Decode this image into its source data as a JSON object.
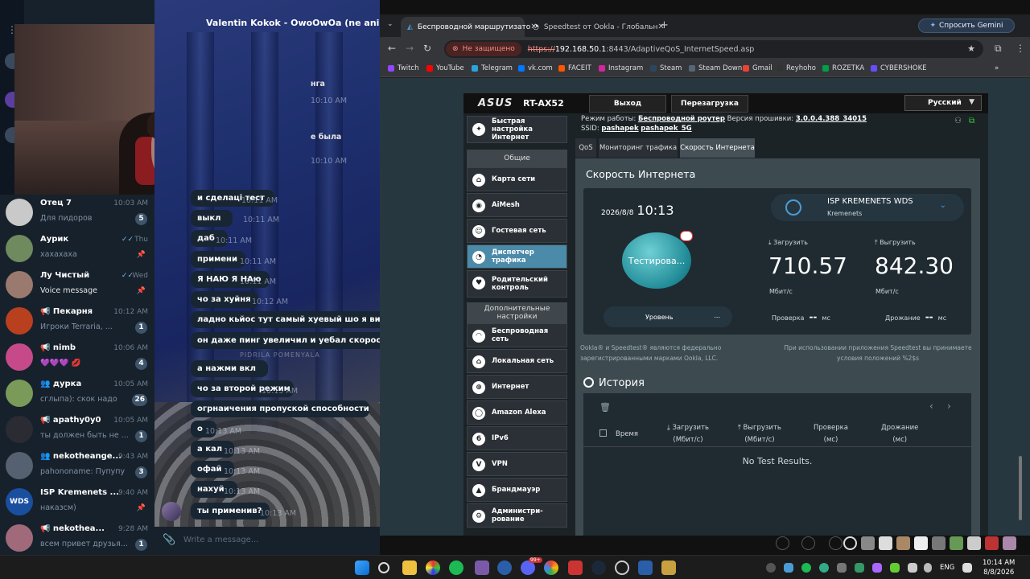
{
  "telegram": {
    "header_name": "Valentin Kokok - OwoOwOa (ne anime)",
    "chats": [
      {
        "name": "Отец 7",
        "time": "10:03 AM",
        "preview": "Для пидоров",
        "badge": "5",
        "avatar_color": "#c9c9c9"
      },
      {
        "name": "Аурик",
        "time": "Thu",
        "preview": "хахахаха",
        "check": "✓✓",
        "pin": true,
        "avatar_color": "#6f8a5e"
      },
      {
        "name": "Лу Чистый",
        "time": "Wed",
        "preview": "Voice message",
        "check": "✓✓",
        "pin": true,
        "avatar_color": "#9a7a6e"
      },
      {
        "name": "📢 Пекарня",
        "time": "10:12 AM",
        "preview": "Игроки Terraria, ...",
        "badge": "1",
        "avatar_color": "#b9401f"
      },
      {
        "name": "📢 nimb",
        "time": "10:06 AM",
        "preview": "💜💜💜 💋",
        "badge": "4",
        "avatar_color": "#c64a8a"
      },
      {
        "name": "👥 дурка",
        "time": "10:05 AM",
        "preview": "сглыпа): скок надо",
        "badge": "26",
        "avatar_color": "#7a9a5a"
      },
      {
        "name": "📢 apathy0y0",
        "time": "10:05 AM",
        "preview": "ты должен быть не ...",
        "badge": "1",
        "avatar_color": "#2b2b33"
      },
      {
        "name": "👥 nekotheange...",
        "time": "9:43 AM",
        "preview": "pahononame: Пупупу",
        "badge": "3",
        "avatar_color": "#556070"
      },
      {
        "name": "ISP Kremenets ...",
        "time": "9:40 AM",
        "preview": "наказсм)",
        "pin": true,
        "avatar_color": "#1a4fa0",
        "avatar_text": "WDS"
      },
      {
        "name": "📢 nekothea...",
        "time": "9:28 AM",
        "preview": "всем привет друзья...",
        "badge": "1",
        "avatar_color": "#a06a7a"
      }
    ],
    "messages": [
      {
        "text": "и сделаці тест",
        "time": "10:11 AM"
      },
      {
        "text": "выкл",
        "time": "10:11 AM"
      },
      {
        "text": "даб",
        "time": "10:11 AM"
      },
      {
        "text": "примени",
        "time": "10:11 AM"
      },
      {
        "text": "Я НАЮ Я НАю",
        "time": "10:11 AM"
      },
      {
        "text": "чо за хуйня",
        "time": "10:12 AM"
      },
      {
        "text": "ладно кьйос тут самый хуевый шо я видел",
        "time": "10:12 AM"
      },
      {
        "text": "он даже пинг увеличил и уебал скорость",
        "time": "10:12 AM"
      },
      {
        "text": "а нажми вкл",
        "time": "10:13 AM"
      },
      {
        "text": "чо за второй режим",
        "time": "10:13 AM"
      },
      {
        "text": "огрнаичения пропуской способности",
        "time": "10:13 AM"
      },
      {
        "text": "о",
        "time": "10:13 AM"
      },
      {
        "text": "а кал",
        "time": "10:13 AM"
      },
      {
        "text": "офай",
        "time": "10:13 AM"
      },
      {
        "text": "нахуй",
        "time": "10:13 AM"
      },
      {
        "text": "ты применив?",
        "time": "10:13 AM"
      }
    ],
    "bg_frag_1": "нга",
    "bg_frag_2": "е была",
    "bg_time_1": "10:10 AM",
    "bg_time_2": "10:10 AM",
    "watermark": "PIDRILA POMENYALA",
    "input_placeholder": "Write a message..."
  },
  "browser": {
    "tabs": [
      {
        "title": "Беспроводной маршрутизато",
        "active": true
      },
      {
        "title": "Speedtest от Ookla - Глобальн",
        "active": false
      }
    ],
    "gemini_label": "Спросить Gemini",
    "security_label": "Не защищено",
    "url_scheme": "https://",
    "url_host": "192.168.50.1",
    "url_rest": ":8443/AdaptiveQoS_InternetSpeed.asp",
    "bookmarks": [
      {
        "label": "Twitch",
        "color": "#9146ff"
      },
      {
        "label": "YouTube",
        "color": "#ff0000"
      },
      {
        "label": "Telegram",
        "color": "#2aa3df"
      },
      {
        "label": "vk.com",
        "color": "#0077ff"
      },
      {
        "label": "FACEIT",
        "color": "#ff5500"
      },
      {
        "label": "Instagram",
        "color": "#d6249f"
      },
      {
        "label": "Steam",
        "color": "#2a475e"
      },
      {
        "label": "Steam Down",
        "color": "#556677"
      },
      {
        "label": "Gmail",
        "color": "#ea4335"
      },
      {
        "label": "Reyhoho",
        "color": "#333333"
      },
      {
        "label": "ROZETKA",
        "color": "#00a046"
      },
      {
        "label": "CYBERSHOKE",
        "color": "#6a4cff"
      }
    ]
  },
  "router": {
    "logo": "ASUS",
    "model": "RT-AX52",
    "logout": "Выход",
    "reboot": "Перезагрузка",
    "language": "Русский",
    "mode_label": "Режим работы:",
    "mode_value": "Беспроводной роутер",
    "fw_label": "Версия прошивки:",
    "fw_value": "3.0.0.4.388_34015",
    "ssid_label": "SSID:",
    "ssid_1": "pashapek",
    "ssid_2": "pashapek_5G",
    "quick_setup": "Быстрая настройка Интернет",
    "general_header": "Общие",
    "general_items": [
      {
        "label": "Карта сети",
        "icon": "map"
      },
      {
        "label": "AiMesh",
        "icon": "mesh"
      },
      {
        "label": "Гостевая сеть",
        "icon": "guest"
      },
      {
        "label": "Диспетчер трафика",
        "icon": "traffic",
        "active": true
      },
      {
        "label": "Родительский контроль",
        "icon": "parental"
      }
    ],
    "advanced_header": "Дополнительные настройки",
    "advanced_items": [
      {
        "label": "Беспроводная сеть",
        "icon": "wifi"
      },
      {
        "label": "Локальная сеть",
        "icon": "lan"
      },
      {
        "label": "Интернет",
        "icon": "wan"
      },
      {
        "label": "Amazon Alexa",
        "icon": "alexa"
      },
      {
        "label": "IPv6",
        "icon": "ipv6"
      },
      {
        "label": "VPN",
        "icon": "vpn"
      },
      {
        "label": "Брандмауэр",
        "icon": "firewall"
      },
      {
        "label": "Администри-рование",
        "icon": "admin"
      }
    ],
    "tabs": [
      "QoS",
      "Мониторинг трафика",
      "Скорость Интернета"
    ],
    "speed_title": "Скорость Интернета",
    "date": "2026/8/8",
    "time": "10:13",
    "isp_name": "ISP KREMENETS WDS",
    "isp_city": "Kremenets",
    "gauge_label": "Тестирова...",
    "download_label": "Загрузить",
    "download_value": "710.57",
    "download_unit": "Мбит/с",
    "upload_label": "Выгрузить",
    "upload_value": "842.30",
    "upload_unit": "Мбит/с",
    "level_label": "Уровень",
    "level_dots": "...",
    "ping_label": "Проверка",
    "ping_value": "--",
    "ping_unit": "мс",
    "jitter_label": "Дрожание",
    "jitter_value": "--",
    "jitter_unit": "мс",
    "ookla_left": "Ookla® и Speedtest® являются федерально зарегистрированными марками Ookla, LLC.",
    "ookla_right": "При использовании приложения Speedtest вы принимаете условия положений %2$s",
    "history_title": "История",
    "hist_cols": [
      {
        "l1": "Время",
        "l2": ""
      },
      {
        "l1": "Загрузить",
        "l2": "(Мбит/с)"
      },
      {
        "l1": "Выгрузить",
        "l2": "(Мбит/с)"
      },
      {
        "l1": "Проверка",
        "l2": "(мс)"
      },
      {
        "l1": "Дрожание",
        "l2": "(мс)"
      }
    ],
    "no_results": "No Test Results."
  },
  "taskbar": {
    "lang": "ENG",
    "time": "10:14 AM",
    "date": "8/8/2026",
    "notif_badge": "99+"
  }
}
